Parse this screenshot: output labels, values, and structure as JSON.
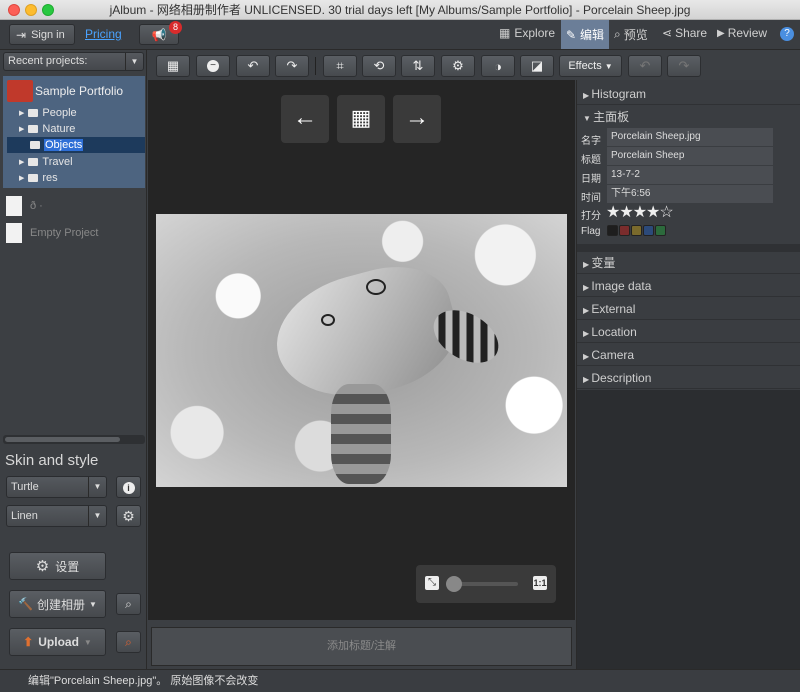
{
  "window": {
    "title": "jAlbum - 网络相册制作者 UNLICENSED. 30 trial days left [My Albums/Sample Portfolio] - Porcelain Sheep.jpg"
  },
  "topbar": {
    "sign_in": "Sign in",
    "pricing": "Pricing",
    "notification_count": "8",
    "explore": "Explore",
    "edit": "编辑",
    "preview": "预览",
    "share": "Share",
    "review": "Review",
    "help": "?"
  },
  "toolbar": {
    "effects": "Effects"
  },
  "left": {
    "recent_label": "Recent projects:",
    "project_name": "Sample Portfolio",
    "folders": [
      "People",
      "Nature",
      "Objects",
      "Travel",
      "res"
    ],
    "selected_folder": "Objects",
    "other_project_1": "ð   ·",
    "other_project_2": "Empty Project",
    "skin_heading": "Skin and style",
    "skin_value": "Turtle",
    "style_value": "Linen",
    "settings_label": "设置",
    "make_album_label": "创建相册",
    "upload_label": "Upload"
  },
  "center": {
    "caption_placeholder": "添加标题/注解",
    "zoom": {
      "level": 0.0
    }
  },
  "right": {
    "histogram": "Histogram",
    "main_panel": "主面板",
    "fields": [
      {
        "label": "名字",
        "value": "Porcelain Sheep.jpg"
      },
      {
        "label": "标题",
        "value": "Porcelain Sheep"
      },
      {
        "label": "日期",
        "value": "13-7-2"
      },
      {
        "label": "时间",
        "value": "下午6:56"
      }
    ],
    "rating_label": "打分",
    "rating": 4,
    "rating_stars": "★★★★☆",
    "flag_label": "Flag",
    "flag_colors": [
      "#1e1e1e",
      "#7a2c2c",
      "#7a6a2c",
      "#2c4a7a",
      "#2c6a3c"
    ],
    "sections": [
      "变量",
      "Image data",
      "External",
      "Location",
      "Camera",
      "Description"
    ]
  },
  "status": {
    "text": "编辑\"Porcelain Sheep.jpg\"。 原始图像不会改变"
  }
}
